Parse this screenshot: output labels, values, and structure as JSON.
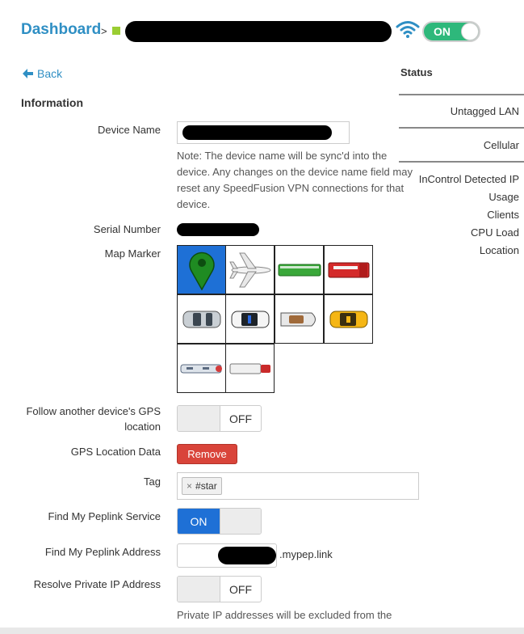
{
  "header": {
    "breadcrumb_root": "Dashboard",
    "breadcrumb_sep": ">",
    "toggle_label": "ON",
    "colors": {
      "link": "#2f8fc4",
      "toggle_on": "#2eb87b",
      "status": "#9acd32"
    }
  },
  "nav": {
    "back_label": "Back"
  },
  "section": {
    "title": "Information"
  },
  "fields": {
    "device_name_label": "Device Name",
    "device_name_note": "Note: The device name will be sync'd into the device. Any changes on the device name field may reset any SpeedFusion VPN connections for that device.",
    "serial_label": "Serial Number",
    "map_marker_label": "Map Marker",
    "follow_gps_label": "Follow another device's GPS location",
    "follow_gps_state": "OFF",
    "gps_data_label": "GPS Location Data",
    "remove_label": "Remove",
    "tag_label": "Tag",
    "tag_value": "#star",
    "tag_remove": "×",
    "find_service_label": "Find My Peplink Service",
    "find_service_state": "ON",
    "find_address_label": "Find My Peplink Address",
    "find_address_suffix": ".mypep.link",
    "resolve_ip_label": "Resolve Private IP Address",
    "resolve_ip_state": "OFF",
    "resolve_ip_note": "Private IP addresses will be excluded from the"
  },
  "map_markers": [
    "pin-marker",
    "airplane-marker",
    "bus-marker",
    "fire-truck-marker",
    "car-marker",
    "police-car-marker",
    "boat-marker",
    "taxi-marker",
    "train-marker",
    "truck-marker"
  ],
  "map_marker_selected": "pin-marker",
  "sidebar": {
    "title": "Status",
    "items": [
      "Untagged LAN",
      "Cellular",
      "InControl Detected IP",
      "Usage",
      "Clients",
      "CPU Load",
      "Location"
    ]
  }
}
